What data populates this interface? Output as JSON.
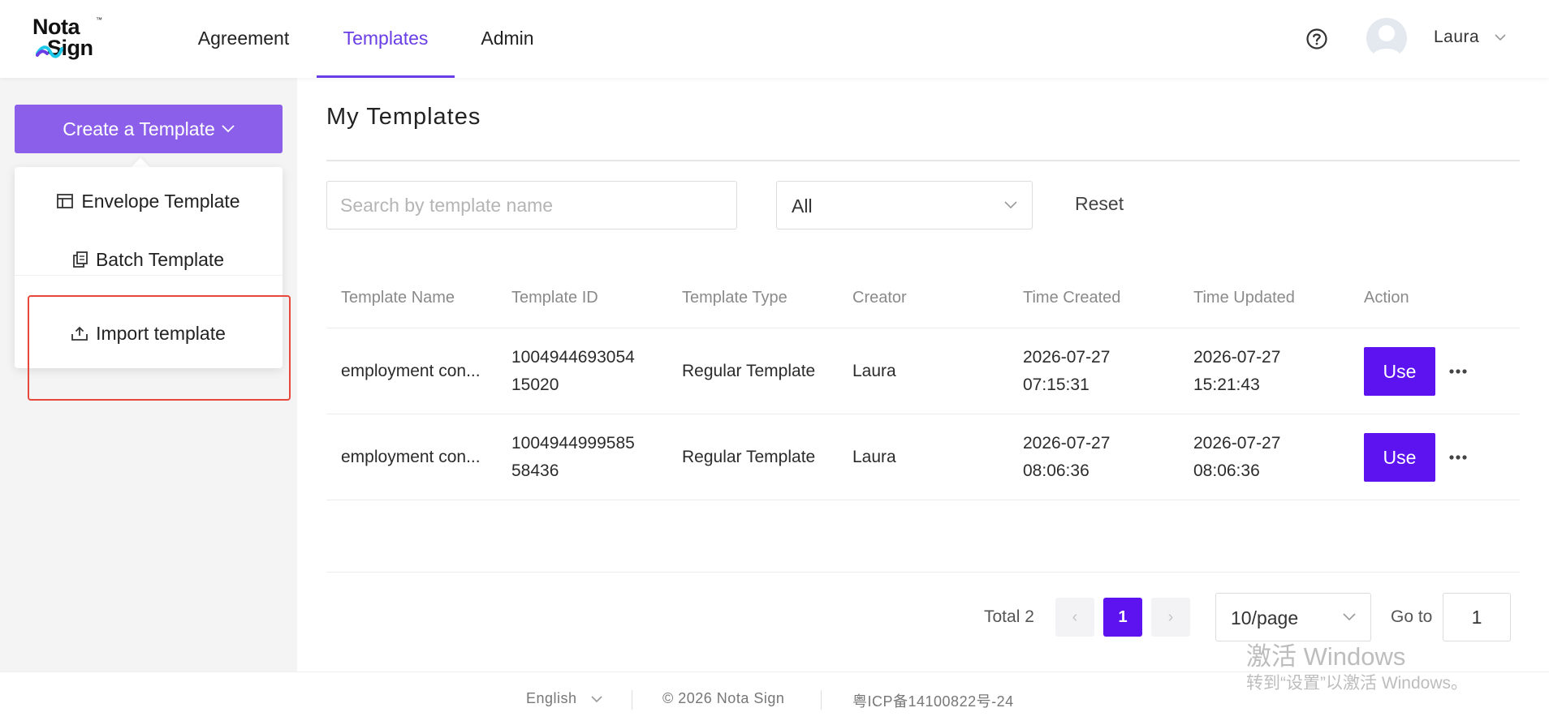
{
  "brand": {
    "line1": "Nota",
    "line2": "Sign",
    "tm": "™"
  },
  "nav": {
    "tabs": [
      {
        "label": "Agreement"
      },
      {
        "label": "Templates"
      },
      {
        "label": "Admin"
      }
    ],
    "active": "Templates"
  },
  "user": {
    "name": "Laura"
  },
  "sidebar": {
    "create_label": "Create a Template",
    "menu": [
      {
        "label": "Envelope Template",
        "icon": "layout-icon"
      },
      {
        "label": "Batch Template",
        "icon": "copy-icon"
      },
      {
        "label": "Import template",
        "icon": "upload-icon"
      }
    ]
  },
  "main": {
    "title": "My Templates",
    "search_placeholder": "Search by template name",
    "search_value": "",
    "type_filter": "All",
    "reset_label": "Reset",
    "columns": [
      "Template Name",
      "Template ID",
      "Template Type",
      "Creator",
      "Time Created",
      "Time Updated",
      "Action"
    ],
    "rows": [
      {
        "name": "employment con...",
        "id_line1": "1004944693054",
        "id_line2": "15020",
        "type": "Regular Template",
        "creator": "Laura",
        "created_date": "2026-07-27",
        "created_time": "07:15:31",
        "updated_date": "2026-07-27",
        "updated_time": "15:21:43",
        "action": "Use"
      },
      {
        "name": "employment con...",
        "id_line1": "1004944999585",
        "id_line2": "58436",
        "type": "Regular Template",
        "creator": "Laura",
        "created_date": "2026-07-27",
        "created_time": "08:06:36",
        "updated_date": "2026-07-27",
        "updated_time": "08:06:36",
        "action": "Use"
      }
    ]
  },
  "pagination": {
    "total_label": "Total 2",
    "prev": "‹",
    "current": "1",
    "next": "›",
    "per_page": "10/page",
    "goto_label": "Go to",
    "goto_value": "1"
  },
  "footer": {
    "language": "English",
    "copyright": "© 2026 Nota Sign",
    "icp": "粤ICP备14100822号-24"
  },
  "watermark": {
    "line1": "激活 Windows",
    "line2": "转到“设置”以激活 Windows。"
  },
  "colors": {
    "accent": "#6a3ee6",
    "primary_button": "#5c13f0",
    "create_button": "#8c5fea",
    "highlight": "#e8483a"
  }
}
